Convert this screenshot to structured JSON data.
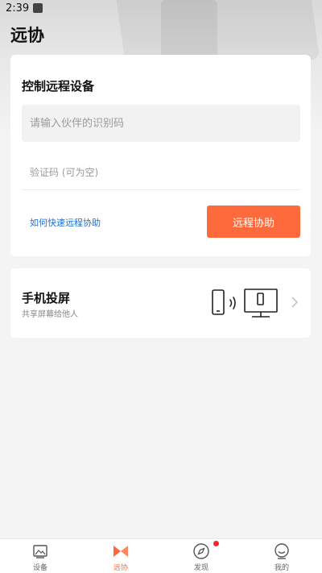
{
  "status_bar": {
    "time": "2:39"
  },
  "header": {
    "title": "远协"
  },
  "remote_control": {
    "title": "控制远程设备",
    "partner_id": {
      "value": "",
      "placeholder": "请输入伙伴的识别码"
    },
    "verification_code": {
      "value": "",
      "placeholder": "验证码 (可为空)"
    },
    "help_link": "如何快速远程协助",
    "assist_button": "远程协助"
  },
  "screen_mirroring": {
    "title": "手机投屏",
    "subtitle": "共享屏幕给他人",
    "icons": [
      "phone-icon",
      "signal-waves-icon",
      "monitor-icon",
      "chevron-right-icon"
    ]
  },
  "tabbar": {
    "items": [
      {
        "label": "设备",
        "icon": "devices-icon"
      },
      {
        "label": "远协",
        "icon": "remote-assist-icon",
        "active": true
      },
      {
        "label": "发现",
        "icon": "compass-icon",
        "badge": true
      },
      {
        "label": "我的",
        "icon": "profile-icon"
      }
    ]
  },
  "colors": {
    "accent": "#ff6a3d",
    "link": "#1e6fd9",
    "badge": "#f02b2b"
  }
}
